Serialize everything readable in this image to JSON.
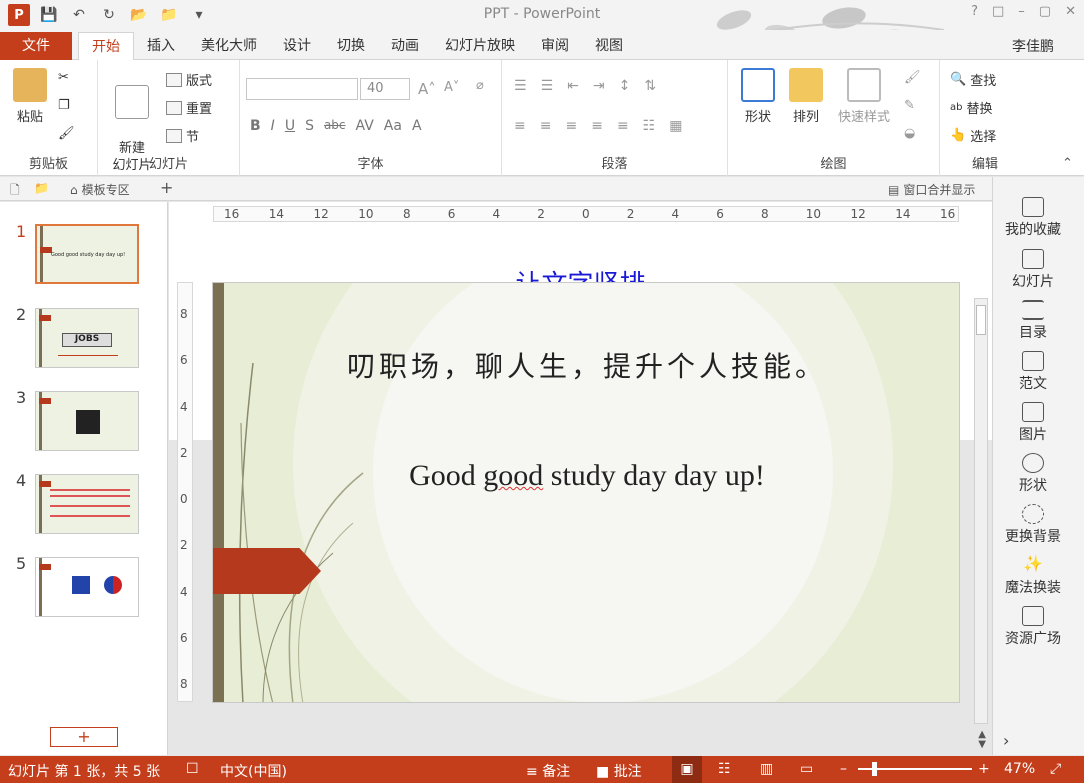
{
  "window": {
    "title": "PPT - PowerPoint",
    "user": "李佳鹏"
  },
  "qat": {
    "logo": "P"
  },
  "tabs": {
    "file": "文件",
    "items": [
      "开始",
      "插入",
      "美化大师",
      "设计",
      "切换",
      "动画",
      "幻灯片放映",
      "审阅",
      "视图"
    ]
  },
  "ribbon": {
    "clipboard": {
      "label": "剪贴板",
      "paste": "粘贴"
    },
    "slides": {
      "label": "幻灯片",
      "new_slide": "新建\n幻灯片",
      "layout": "版式",
      "reset": "重置",
      "section": "节"
    },
    "font": {
      "label": "字体",
      "name": "",
      "size": "40",
      "bold": "B",
      "italic": "I",
      "underline": "U",
      "shadow": "S",
      "strike": "abc",
      "spacing": "AV",
      "case": "Aa",
      "color": "A"
    },
    "paragraph": {
      "label": "段落"
    },
    "drawing": {
      "label": "绘图",
      "shapes": "形状",
      "arrange": "排列",
      "quick_styles": "快速样式"
    },
    "editing": {
      "label": "编辑",
      "find": "查找",
      "replace": "替换",
      "select": "选择"
    }
  },
  "docbar": {
    "template_zone": "模板专区",
    "add": "+",
    "window_merge": "窗口合并显示"
  },
  "thumbnails": [
    {
      "num": "1",
      "text": "Good good study day day up!"
    },
    {
      "num": "2",
      "text": "JOBS"
    },
    {
      "num": "3",
      "text": ""
    },
    {
      "num": "4",
      "text": ""
    },
    {
      "num": "5",
      "text": ""
    }
  ],
  "add_slide": "+",
  "editor": {
    "heading": "让文字竖排",
    "slide_line1": "叨职场，聊人生，提升个人技能。",
    "slide_line2_a": "Good ",
    "slide_line2_b": "good",
    "slide_line2_c": " study day day up!"
  },
  "ruler": {
    "h": [
      "16",
      "14",
      "12",
      "10",
      "8",
      "6",
      "4",
      "2",
      "0",
      "2",
      "4",
      "6",
      "8",
      "10",
      "12",
      "14",
      "16"
    ],
    "v": [
      "8",
      "6",
      "4",
      "2",
      "0",
      "2",
      "4",
      "6",
      "8"
    ]
  },
  "right_panel": [
    "我的收藏",
    "幻灯片",
    "目录",
    "范文",
    "图片",
    "形状",
    "更换背景",
    "魔法换装",
    "资源广场"
  ],
  "status": {
    "slide_info": "幻灯片 第 1 张，共 5 张",
    "language": "中文(中国)",
    "notes": "备注",
    "comments": "批注",
    "zoom": "47%"
  },
  "colors": {
    "accent": "#c43e1c",
    "title_blue": "#1a1ad6",
    "slide_bg": "#e8edd6"
  }
}
